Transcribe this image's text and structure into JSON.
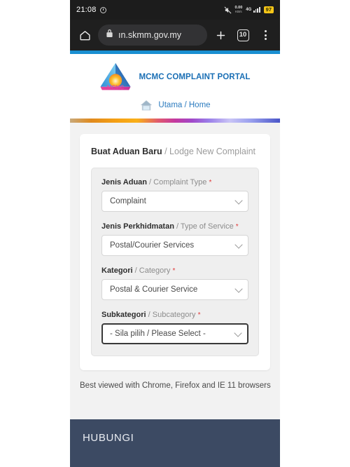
{
  "status_bar": {
    "time": "21:08",
    "alarm_icon": "alarm-icon",
    "mute_icon": "mute-icon",
    "data_rate": "0.00",
    "data_unit": "KB/s",
    "network": "4G",
    "battery": "97"
  },
  "browser": {
    "home_icon": "home-icon",
    "lock_icon": "lock-icon",
    "url": "ın.skmm.gov.my",
    "new_tab_icon": "plus-icon",
    "tab_count": "10",
    "menu_icon": "kebab-menu-icon"
  },
  "site": {
    "logo_icon": "mcmc-logo",
    "logo_text": "MCMC",
    "title": "MCMC COMPLAINT PORTAL",
    "breadcrumb_icon": "house-icon",
    "breadcrumb": "Utama / Home"
  },
  "form": {
    "heading_bold": "Buat Aduan Baru",
    "heading_rest": " / Lodge New Complaint",
    "required_mark": "*",
    "fields": [
      {
        "label_bold": "Jenis Aduan",
        "label_rest": " / Complaint Type",
        "value": "Complaint",
        "focused": false,
        "name": "complaint-type-select"
      },
      {
        "label_bold": "Jenis Perkhidmatan",
        "label_rest": " / Type of Service",
        "value": "Postal/Courier Services",
        "focused": false,
        "name": "type-of-service-select"
      },
      {
        "label_bold": "Kategori",
        "label_rest": " / Category",
        "value": "Postal & Courier Service",
        "focused": false,
        "name": "category-select"
      },
      {
        "label_bold": "Subkategori",
        "label_rest": " / Subcategory",
        "value": "- Sila pilih / Please Select -",
        "focused": true,
        "name": "subcategory-select"
      }
    ]
  },
  "footer": {
    "best_viewed": "Best viewed with Chrome, Firefox and IE 11 browsers",
    "heading": "HUBUNGI"
  },
  "colors": {
    "brand_blue": "#1a6fb5",
    "rule_blue": "#1a8fd1",
    "footer_navy": "#3c4a63",
    "required_red": "#e03b3b",
    "battery_yellow": "#f5c518"
  }
}
